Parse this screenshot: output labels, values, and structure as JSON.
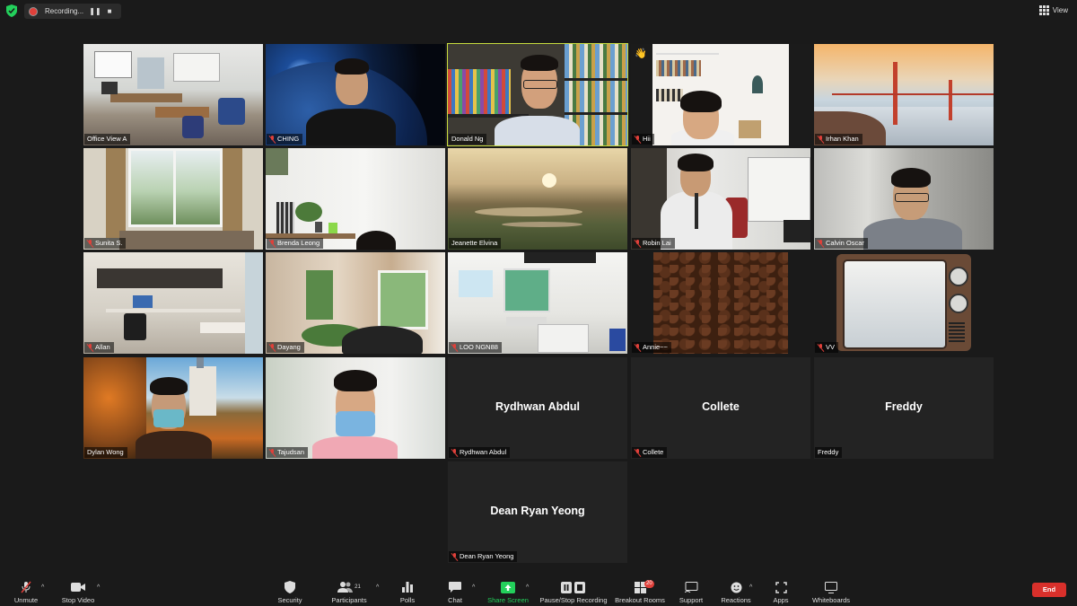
{
  "top_bar": {
    "recording_label": "Recording...",
    "pause_symbol": "❚❚",
    "stop_symbol": "■",
    "view_label": "View"
  },
  "participants": [
    {
      "name": "Office View A",
      "muted": false
    },
    {
      "name": "CHING",
      "muted": true
    },
    {
      "name": "Donald Ng",
      "muted": false
    },
    {
      "name": "Hii",
      "muted": true
    },
    {
      "name": "Irhan Khan",
      "muted": true
    },
    {
      "name": "Sunita S.",
      "muted": true
    },
    {
      "name": "Brenda Leong",
      "muted": true
    },
    {
      "name": "Jeanette Elvina",
      "muted": false
    },
    {
      "name": "Robin Lai",
      "muted": true
    },
    {
      "name": "Calvin Oscar",
      "muted": true
    },
    {
      "name": "Allan",
      "muted": true
    },
    {
      "name": "Dayang",
      "muted": true
    },
    {
      "name": "LOO NGN88",
      "muted": true
    },
    {
      "name": "Annie~~",
      "muted": true
    },
    {
      "name": "VV",
      "muted": true
    },
    {
      "name": "Dylan Wong",
      "muted": false
    },
    {
      "name": "Tajudsan",
      "muted": true
    },
    {
      "name": "Rydhwan Abdul",
      "muted": true,
      "display": "Rydhwan Abdul"
    },
    {
      "name": "Collete",
      "muted": true,
      "display": "Collete"
    },
    {
      "name": "Freddy",
      "muted": false,
      "display": "Freddy"
    },
    {
      "name": "Dean Ryan Yeong",
      "muted": true,
      "display": "Dean Ryan Yeong"
    }
  ],
  "hand_emoji": "👋",
  "toolbar": {
    "unmute": "Unmute",
    "stop_video": "Stop Video",
    "security": "Security",
    "participants": "Participants",
    "participants_count": "21",
    "polls": "Polls",
    "chat": "Chat",
    "share_screen": "Share Screen",
    "pause_stop_recording": "Pause/Stop Recording",
    "breakout_rooms": "Breakout Rooms",
    "breakout_badge": "20",
    "support": "Support",
    "reactions": "Reactions",
    "apps": "Apps",
    "whiteboards": "Whiteboards",
    "end": "End"
  },
  "colors": {
    "active_speaker": "#c7db3e",
    "share_green": "#23d05b",
    "end_red": "#d9302b",
    "muted_red": "#e0403a"
  }
}
